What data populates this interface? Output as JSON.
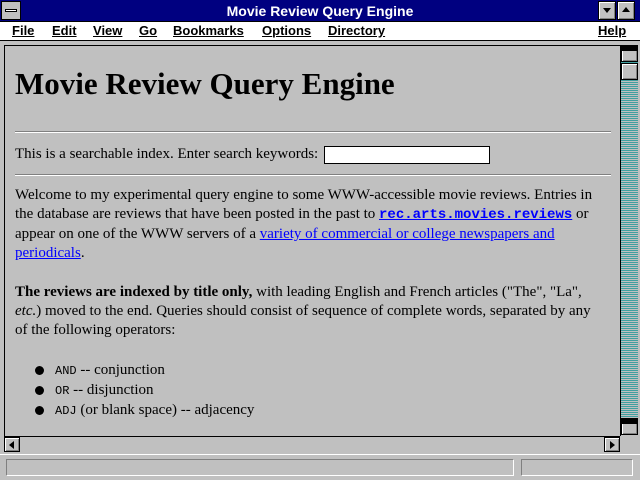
{
  "window": {
    "title": "Movie Review Query Engine"
  },
  "menu": {
    "file": "File",
    "edit": "Edit",
    "view": "View",
    "go": "Go",
    "bookmarks": "Bookmarks",
    "options": "Options",
    "directory": "Directory",
    "help": "Help"
  },
  "page": {
    "heading": "Movie Review Query Engine",
    "search_label": "This is a searchable index. Enter search keywords:",
    "search_value": "",
    "p1_a": "Welcome to my experimental query engine to some WWW-accessible movie reviews. Entries in the database are reviews that have been posted in the past to ",
    "p1_link1": "rec.arts.movies.reviews",
    "p1_b": " or appear on one of the WWW servers of a ",
    "p1_link2": "variety of commercial or college newspapers and periodicals",
    "p1_c": ".",
    "p2_bold": "The reviews are indexed by title only,",
    "p2_a": " with leading English and French articles (\"The\", \"La\", ",
    "p2_em": "etc.",
    "p2_b": ") moved to the end. Queries should consist of sequence of complete words, separated by any of the following operators:",
    "operators": [
      {
        "kw": "AND",
        "desc": " -- conjunction"
      },
      {
        "kw": "OR",
        "desc": " -- disjunction"
      },
      {
        "kw": "ADJ",
        "desc": " (or blank space) -- adjacency"
      }
    ]
  },
  "status": {
    "text": ""
  },
  "colors": {
    "titlebar": "#000080",
    "link": "#0000ff",
    "background": "#c0c0c0"
  }
}
